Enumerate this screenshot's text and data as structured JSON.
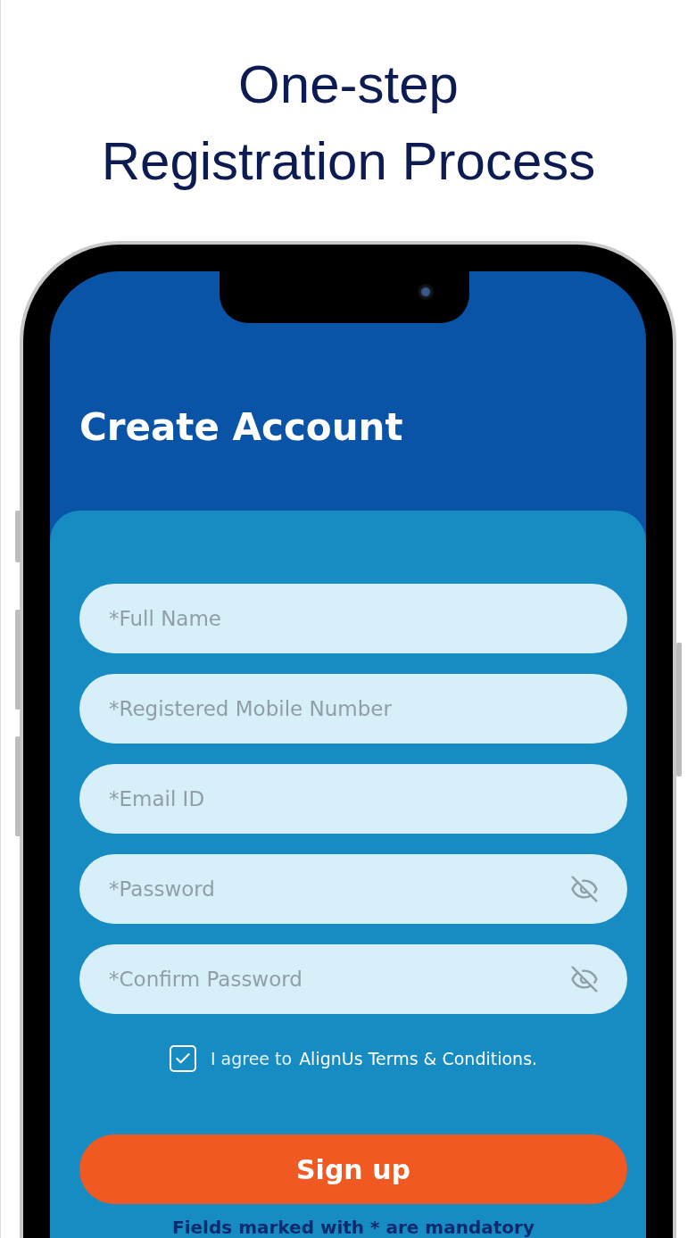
{
  "headline": [
    "One-step",
    "Registration Process"
  ],
  "screen": {
    "title": "Create Account",
    "fields": [
      {
        "placeholder": "*Full Name",
        "kind": "text"
      },
      {
        "placeholder": "*Registered Mobile Number",
        "kind": "text"
      },
      {
        "placeholder": "*Email ID",
        "kind": "text"
      },
      {
        "placeholder": "*Password",
        "kind": "password"
      },
      {
        "placeholder": "*Confirm Password",
        "kind": "password"
      }
    ],
    "agreement": {
      "checked": true,
      "prefix": "I agree to",
      "link": "AlignUs Terms & Conditions."
    },
    "submit": "Sign up",
    "note": "Fields marked with * are mandatory"
  }
}
